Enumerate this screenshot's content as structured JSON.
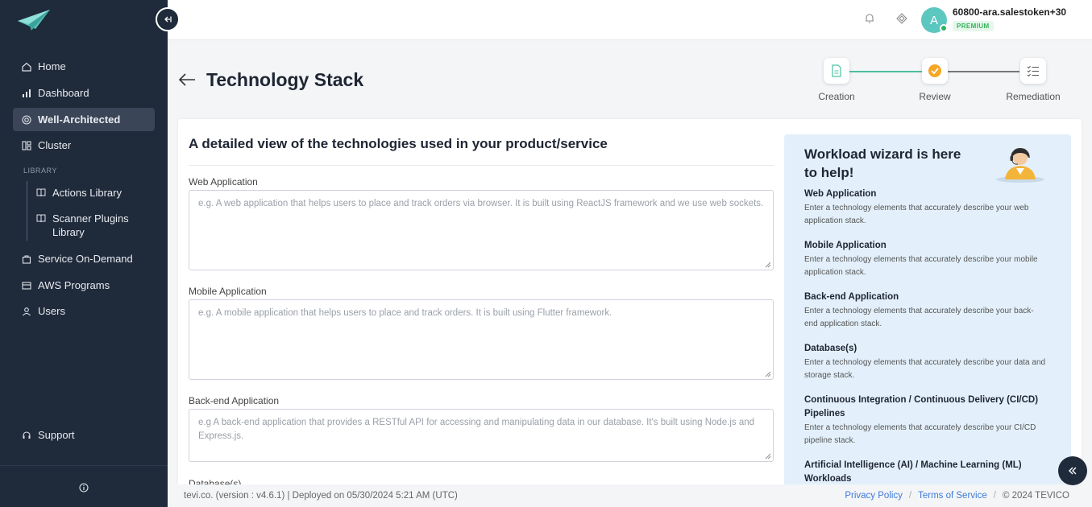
{
  "sidebar": {
    "items": [
      {
        "label": "Home",
        "icon": "home-icon"
      },
      {
        "label": "Dashboard",
        "icon": "bar-chart-icon"
      },
      {
        "label": "Well-Architected",
        "icon": "target-icon"
      },
      {
        "label": "Cluster",
        "icon": "cluster-icon"
      }
    ],
    "library_heading": "LIBRARY",
    "library_items": [
      {
        "label": "Actions Library",
        "icon": "book-icon"
      },
      {
        "label": "Scanner Plugins Library",
        "icon": "book-icon"
      }
    ],
    "lower_items": [
      {
        "label": "Service On-Demand",
        "icon": "bag-icon"
      },
      {
        "label": "AWS Programs",
        "icon": "programs-icon"
      },
      {
        "label": "Users",
        "icon": "user-icon"
      }
    ],
    "support_label": "Support"
  },
  "topbar": {
    "avatar_letter": "A",
    "username": "60800-ara.salestoken+30",
    "plan_badge": "PREMIUM"
  },
  "page": {
    "title": "Technology Stack"
  },
  "stepper": {
    "steps": [
      {
        "label": "Creation",
        "state": "done"
      },
      {
        "label": "Review",
        "state": "current"
      },
      {
        "label": "Remediation",
        "state": "pending"
      }
    ],
    "accent": "#4cc0a0",
    "current_color": "#f5a623"
  },
  "form": {
    "heading": "A detailed view of the technologies used in your product/service",
    "fields": [
      {
        "label": "Web Application",
        "placeholder": "e.g. A web application that helps users to place and track orders via browser. It is built using ReactJS framework and we use web sockets."
      },
      {
        "label": "Mobile Application",
        "placeholder": "e.g. A mobile application that helps users to place and track orders. It is built using Flutter framework."
      },
      {
        "label": "Back-end Application",
        "placeholder": "e.g A back-end application that provides a RESTful API for accessing and manipulating data in our database. It's built using Node.js and Express.js."
      },
      {
        "label": "Database(s)"
      }
    ]
  },
  "help": {
    "title": "Workload wizard is here to help!",
    "items": [
      {
        "title": "Web Application",
        "text": "Enter a technology elements that accurately describe your web application stack."
      },
      {
        "title": "Mobile Application",
        "text": "Enter a technology elements that accurately describe your mobile application stack."
      },
      {
        "title": "Back-end Application",
        "text": "Enter a technology elements that accurately describe your back-end application stack."
      },
      {
        "title": "Database(s)",
        "text": "Enter a technology elements that accurately describe your data and storage stack."
      },
      {
        "title": "Continuous Integration / Continuous Delivery (CI/CD) Pipelines",
        "text": "Enter a technology elements that accurately describe your CI/CD pipeline stack."
      },
      {
        "title": "Artificial Intelligence (AI) / Machine Learning (ML) Workloads"
      }
    ]
  },
  "footer": {
    "left": "tevi.co. (version : v4.6.1) | Deployed on 05/30/2024 5:21 AM (UTC)",
    "privacy": "Privacy Policy",
    "terms": "Terms of Service",
    "copyright": "© 2024 TEVICO"
  }
}
